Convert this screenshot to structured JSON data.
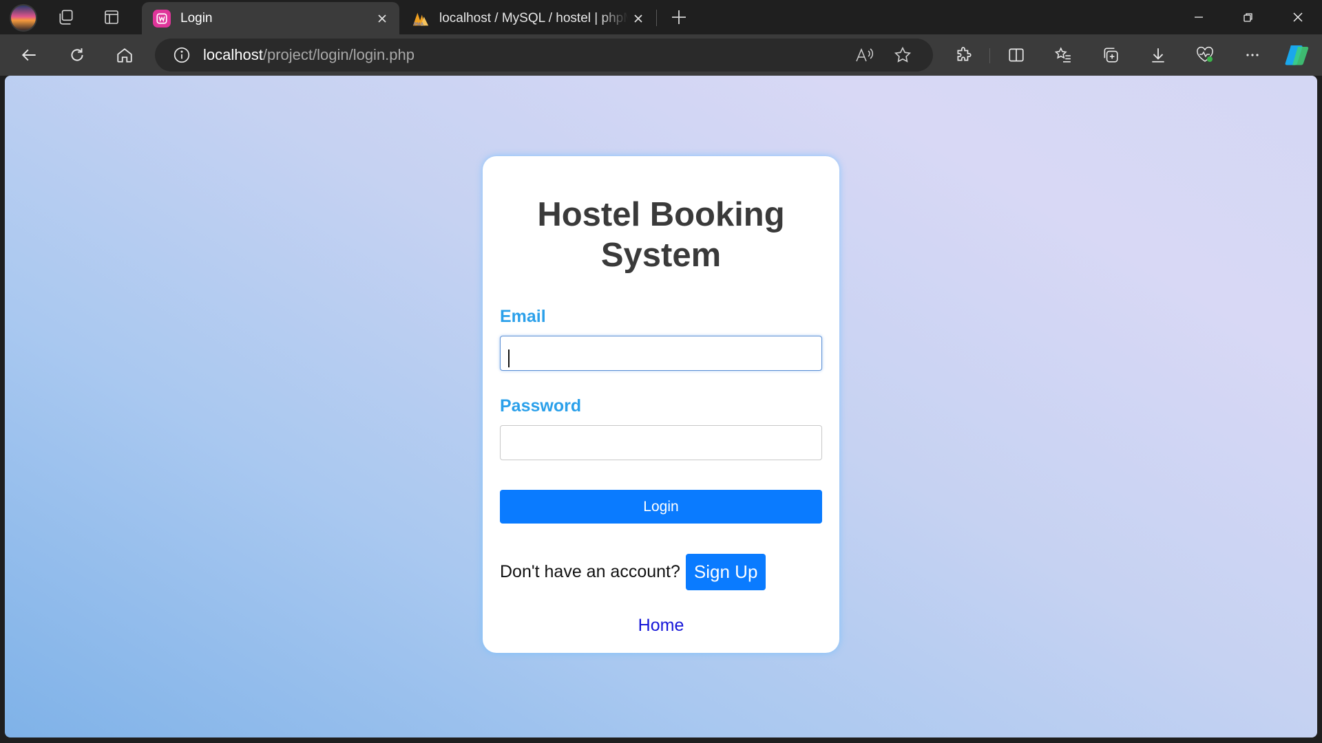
{
  "browser": {
    "tabs": [
      {
        "title": "Login",
        "active": true,
        "icon": "site-favicon-w"
      },
      {
        "title": "localhost / MySQL / hostel | phpMyAdmin",
        "active": false,
        "icon": "phpmyadmin-favicon"
      }
    ],
    "address": {
      "host": "localhost",
      "path": "/project/login/login.php"
    },
    "accent_color": "#2ba0ea"
  },
  "page": {
    "title": "Hostel Booking System",
    "email_label": "Email",
    "email_value": "",
    "password_label": "Password",
    "password_value": "",
    "login_label": "Login",
    "signup_prompt": "Don't have an account?",
    "signup_label": "Sign Up",
    "home_label": "Home",
    "primary_color": "#0a7bff",
    "link_color": "#1515d8"
  }
}
